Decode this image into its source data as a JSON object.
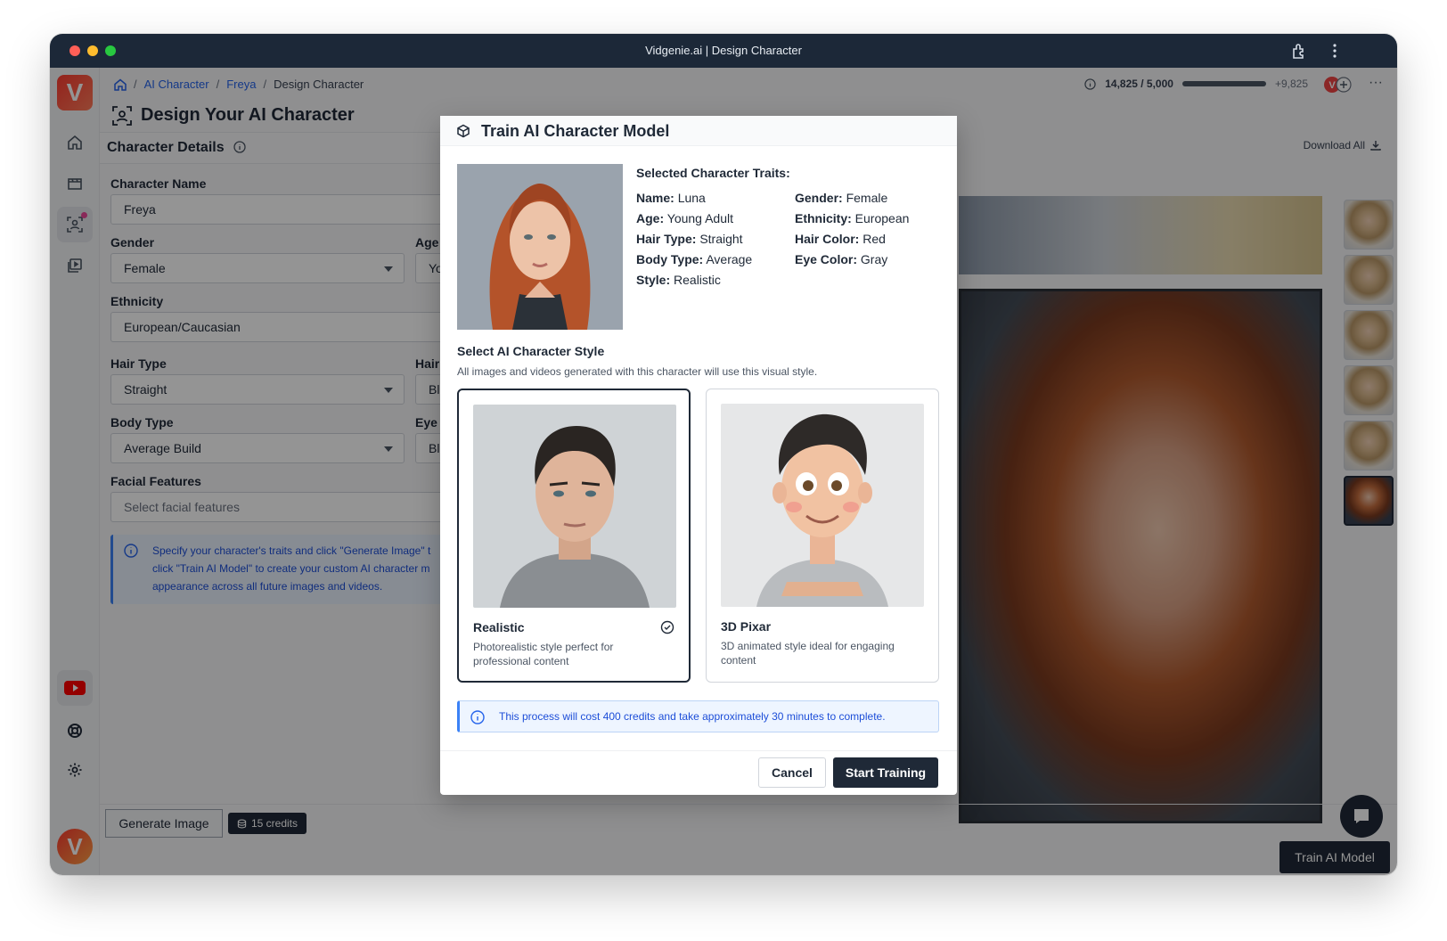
{
  "window": {
    "title": "Vidgenie.ai | Design Character"
  },
  "breadcrumb": {
    "home_icon": "home-icon",
    "items": [
      "AI Character",
      "Freya",
      "Design Character"
    ]
  },
  "credits": {
    "used": "14,825 / 5,000",
    "extra": "+9,825",
    "progress": 1.0
  },
  "page": {
    "title": "Design Your AI Character"
  },
  "character_details": {
    "title": "Character Details",
    "download_all": "Download All",
    "fields": {
      "name": {
        "label": "Character Name",
        "value": "Freya"
      },
      "gender": {
        "label": "Gender",
        "value": "Female"
      },
      "age": {
        "label": "Age",
        "value": "Yo"
      },
      "ethnicity": {
        "label": "Ethnicity",
        "value": "European/Caucasian"
      },
      "hair_type": {
        "label": "Hair Type",
        "value": "Straight"
      },
      "hair_color": {
        "label": "Hair",
        "value": "Bl"
      },
      "body_type": {
        "label": "Body Type",
        "value": "Average Build"
      },
      "eye_color": {
        "label": "Eye",
        "value": "Bl"
      },
      "facial_features": {
        "label": "Facial Features",
        "placeholder": "Select facial features"
      }
    },
    "info": {
      "line1": "Specify your character's traits and click \"Generate Image\" t",
      "line2": "click \"Train AI Model\" to create your custom AI character m",
      "line3": "appearance across all future images and videos."
    }
  },
  "actions": {
    "generate_image": "Generate Image",
    "generate_cost": "15 credits",
    "train_model": "Train AI Model"
  },
  "modal": {
    "title": "Train AI Character Model",
    "traits_title": "Selected Character Traits:",
    "traits": [
      {
        "key": "Name:",
        "value": "Luna"
      },
      {
        "key": "Gender:",
        "value": "Female"
      },
      {
        "key": "Age:",
        "value": "Young Adult"
      },
      {
        "key": "Ethnicity:",
        "value": "European"
      },
      {
        "key": "Hair Type:",
        "value": "Straight"
      },
      {
        "key": "Hair Color:",
        "value": "Red"
      },
      {
        "key": "Body Type:",
        "value": "Average"
      },
      {
        "key": "Eye Color:",
        "value": "Gray"
      },
      {
        "key": "Style:",
        "value": "Realistic"
      }
    ],
    "style_section": {
      "title": "Select AI Character Style",
      "subtitle": "All images and videos generated with this character will use this visual style."
    },
    "styles": [
      {
        "name": "Realistic",
        "description": "Photorealistic style perfect for professional content",
        "selected": true
      },
      {
        "name": "3D Pixar",
        "description": "3D animated style ideal for engaging content",
        "selected": false
      }
    ],
    "notice": "This process will cost 400 credits and take approximately 30 minutes to complete.",
    "cancel": "Cancel",
    "start": "Start Training"
  }
}
